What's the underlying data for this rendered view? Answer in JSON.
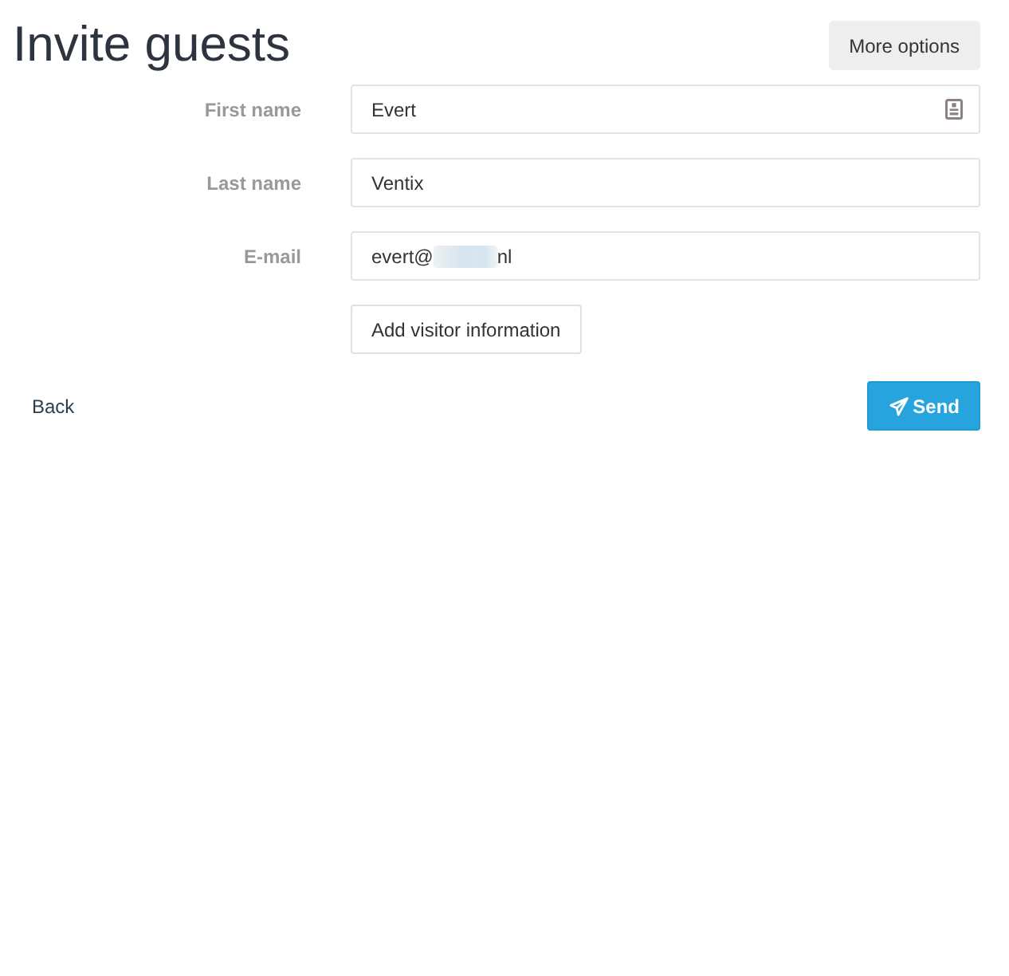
{
  "header": {
    "title": "Invite guests",
    "more_options_button": "More options"
  },
  "form": {
    "fields": [
      {
        "label": "First name",
        "value": "Evert",
        "kind": "card"
      },
      {
        "label": "Last name",
        "value": "Ventix",
        "kind": "plain"
      },
      {
        "label": "E-mail",
        "value": "evert@",
        "value_end": "nl",
        "kind": "redacted"
      }
    ],
    "add_button": "Add visitor information"
  },
  "actions": {
    "back_link": "Back",
    "send_button": "Send"
  }
}
